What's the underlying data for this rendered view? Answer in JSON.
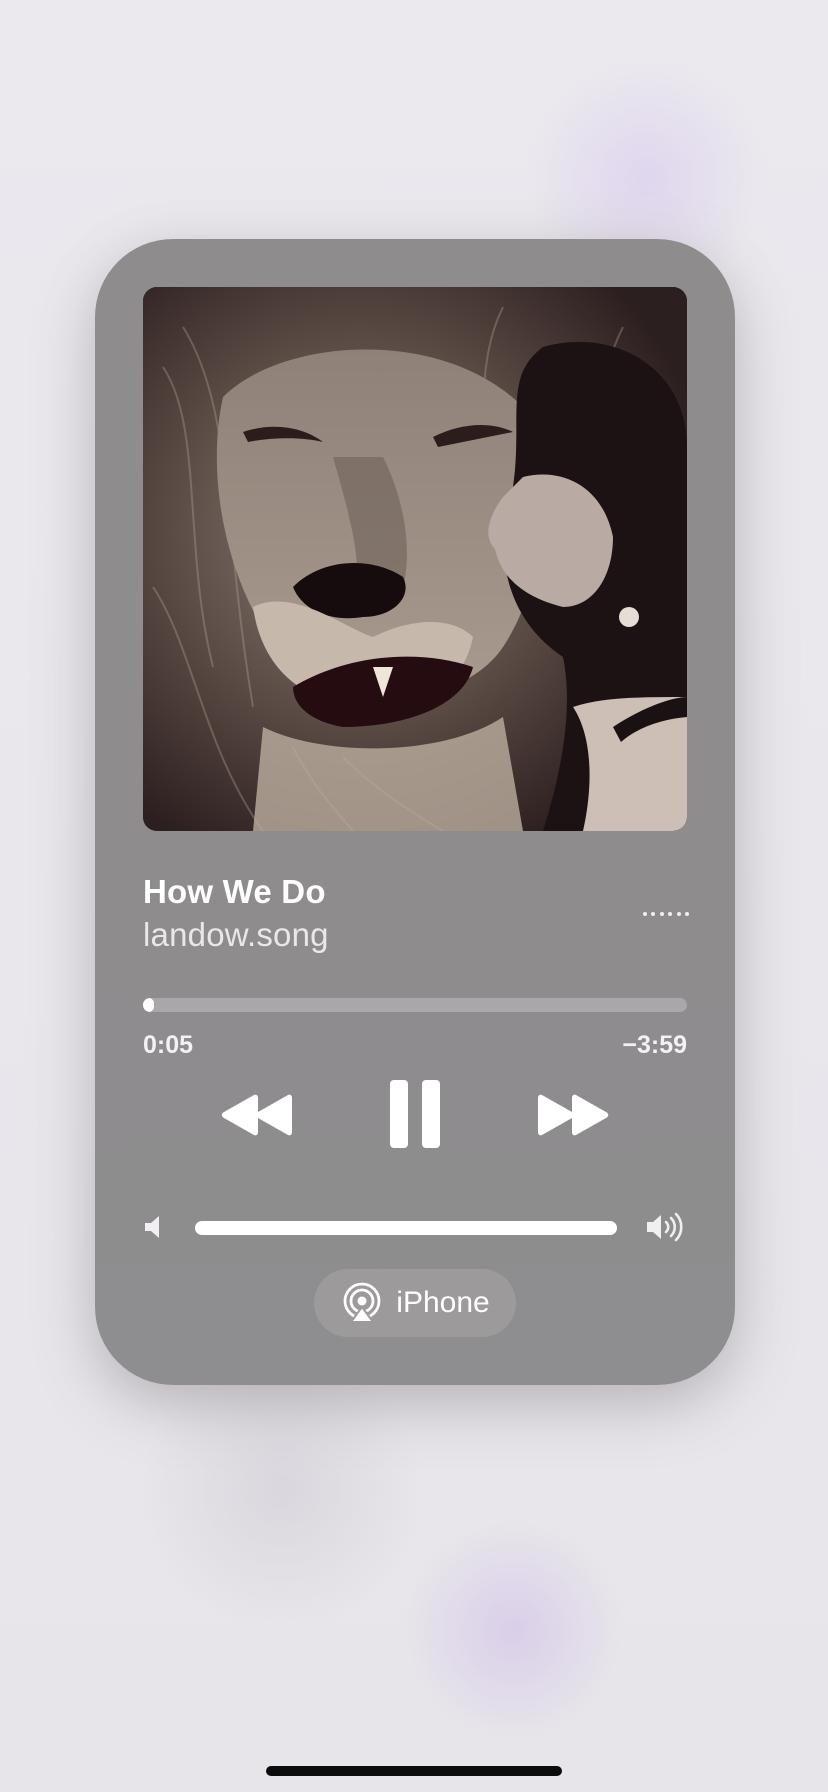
{
  "player": {
    "title": "How We Do",
    "artist": "landow.song",
    "elapsed": "0:05",
    "remaining": "−3:59",
    "progress_fraction": 0.02,
    "volume_fraction": 1.0,
    "artwork": "lion-and-woman-sepia-photo"
  },
  "output": {
    "label": "iPhone",
    "icon": "airplay-audio-icon"
  },
  "icons": {
    "more": "more-dots-icon",
    "rewind": "rewind-icon",
    "pause": "pause-icon",
    "forward": "fast-forward-icon",
    "volume_low": "speaker-low-icon",
    "volume_high": "speaker-high-icon"
  },
  "colors": {
    "card_background": "#8f8c8d",
    "progress_track": "#aaa7aa",
    "progress_fill": "#ffffff",
    "text": "#ffffff"
  }
}
